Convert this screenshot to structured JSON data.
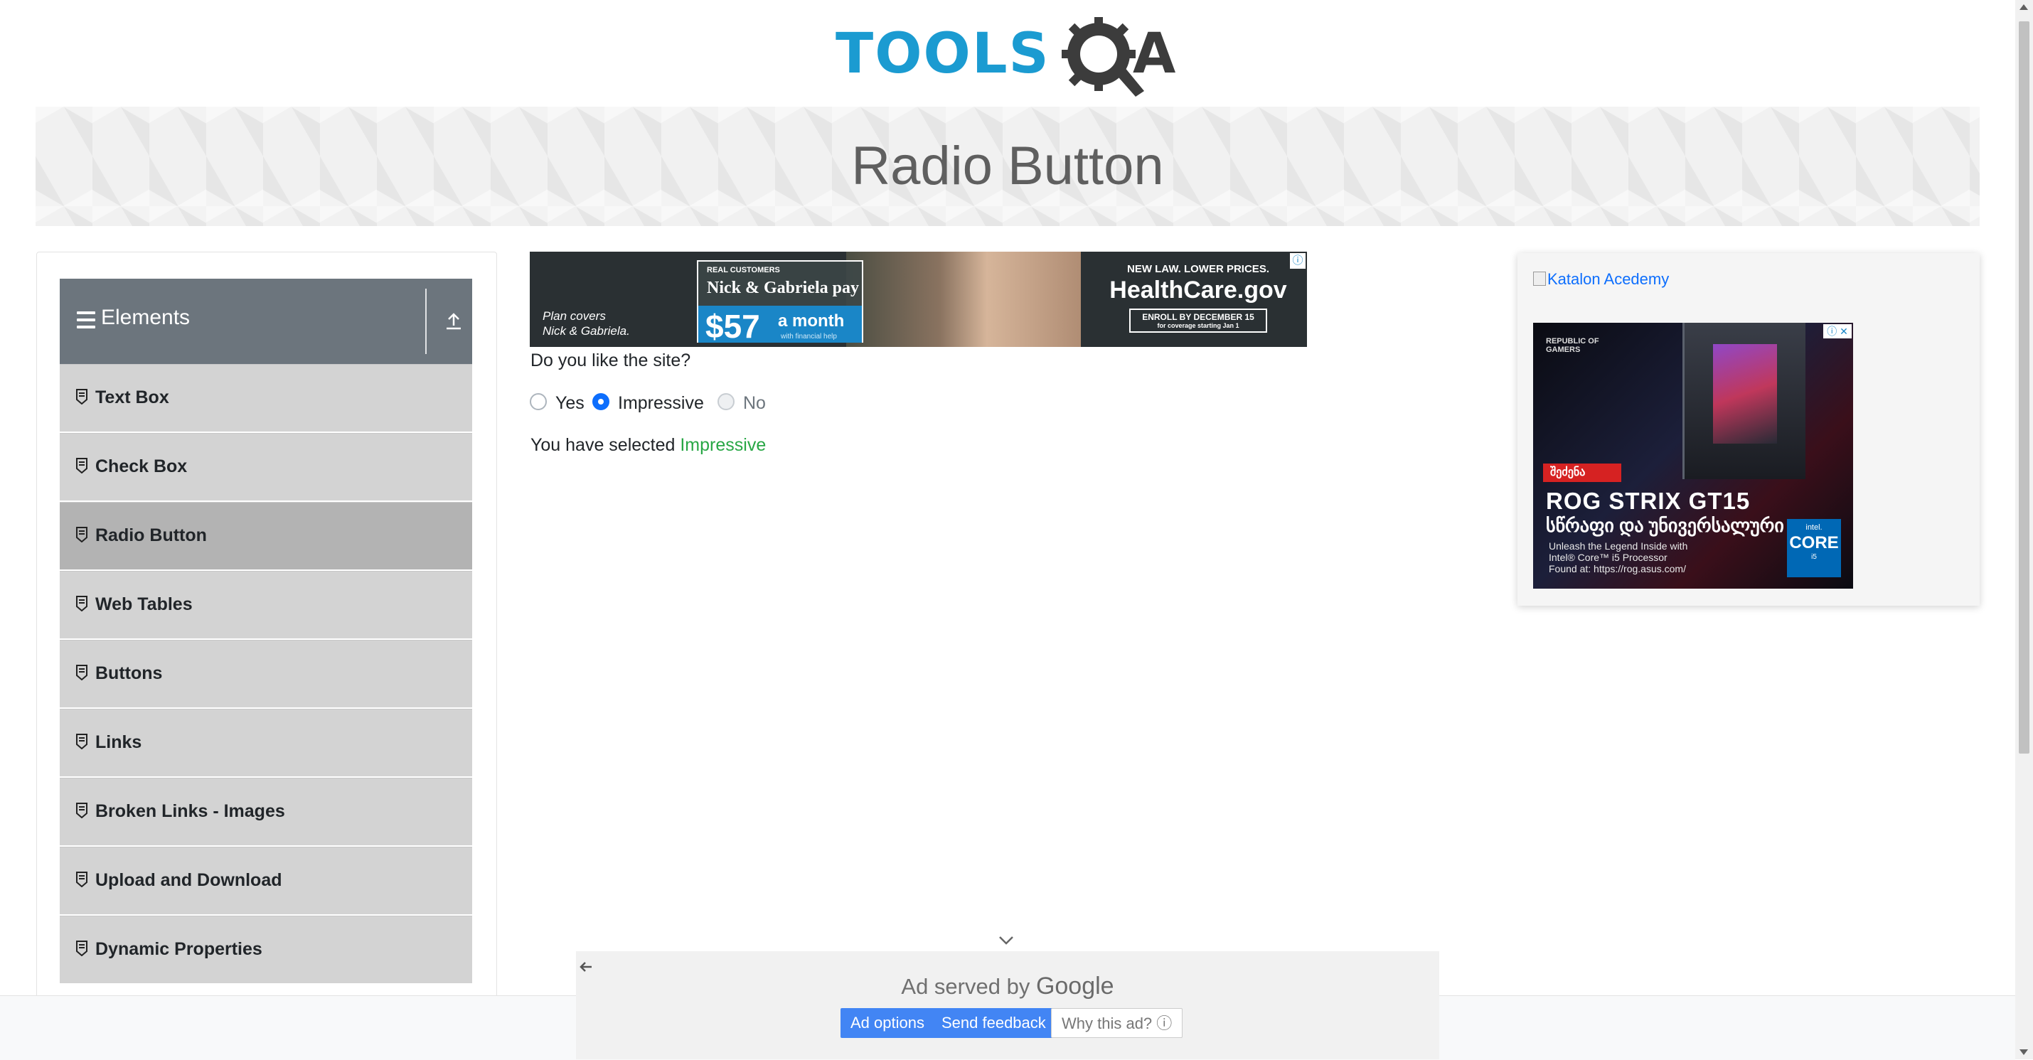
{
  "logo": {
    "text_tools": "TOOLS",
    "text_a": "A"
  },
  "banner": {
    "title": "Radio Button"
  },
  "sidebar": {
    "group_title": "Elements",
    "items": [
      {
        "label": "Text Box"
      },
      {
        "label": "Check Box"
      },
      {
        "label": "Radio Button",
        "active": true
      },
      {
        "label": "Web Tables"
      },
      {
        "label": "Buttons"
      },
      {
        "label": "Links"
      },
      {
        "label": "Broken Links - Images"
      },
      {
        "label": "Upload and Download"
      },
      {
        "label": "Dynamic Properties"
      }
    ]
  },
  "top_ad": {
    "left_text_1": "Plan covers",
    "left_text_2": "Nick & Gabriela.",
    "real_customers": "REAL CUSTOMERS",
    "names": "Nick & Gabriela pay",
    "price": "$57",
    "per": "a month",
    "help": "with financial help",
    "law": "NEW LAW. LOWER PRICES.",
    "site": "HealthCare.gov",
    "enroll": "ENROLL BY DECEMBER 15",
    "coverage": "for coverage starting Jan 1"
  },
  "main": {
    "question": "Do you like the site?",
    "options": [
      {
        "label": "Yes",
        "state": "unchecked"
      },
      {
        "label": "Impressive",
        "state": "checked"
      },
      {
        "label": "No",
        "state": "disabled"
      }
    ],
    "result_prefix": "You have selected ",
    "result_value": "Impressive"
  },
  "right_ad": {
    "link_text": "Katalon Acedemy",
    "brand": "REPUBLIC OF GAMERS",
    "buy": "შეძენა",
    "headline": "ROG STRIX GT15",
    "subhead": "სწრაფი და უნივერსალური",
    "desc_1": "Unleash the Legend Inside with",
    "desc_2": "Intel® Core™ i5 Processor",
    "desc_3": "Found at: https://rog.asus.com/",
    "intel_1": "intel.",
    "intel_2": "CORE",
    "intel_3": "i5"
  },
  "bottom_ad": {
    "served_by": "Ad served by ",
    "google": "Google",
    "ad_options": "Ad options",
    "send_feedback": "Send feedback",
    "why": "Why this ad? ⓘ"
  },
  "colors": {
    "accent": "#0d6efd",
    "success": "#28a745",
    "header_bg": "#6c757d",
    "menu_bg": "#d3d3d3",
    "menu_active": "#b3b3b3"
  }
}
